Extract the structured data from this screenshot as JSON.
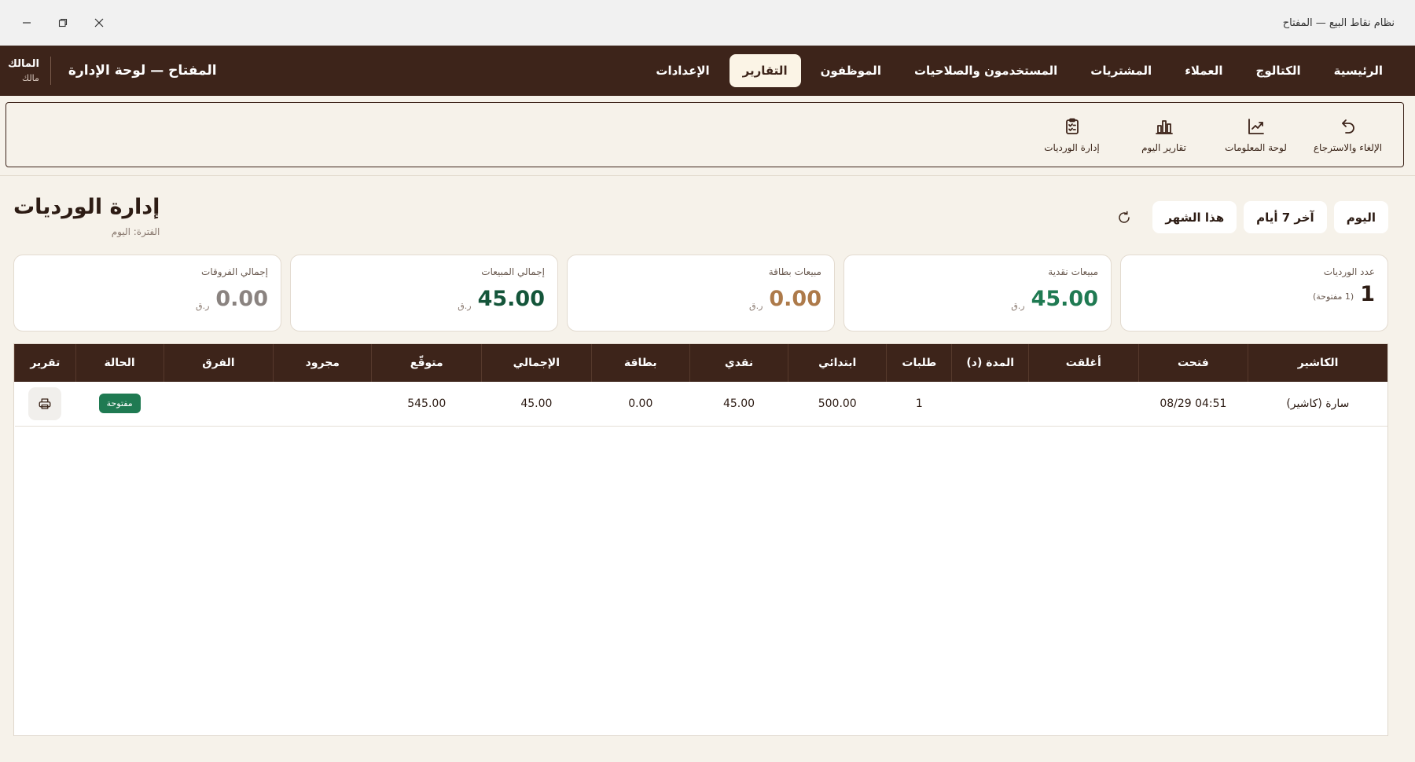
{
  "window": {
    "title": "نظام نقاط البيع — المفتاح"
  },
  "nav": {
    "tabs": [
      {
        "label": "الرئيسية",
        "active": false
      },
      {
        "label": "الكتالوج",
        "active": false
      },
      {
        "label": "العملاء",
        "active": false
      },
      {
        "label": "المشتريات",
        "active": false
      },
      {
        "label": "المستخدمون والصلاحيات",
        "active": false
      },
      {
        "label": "الموظفون",
        "active": false
      },
      {
        "label": "التقارير",
        "active": true
      },
      {
        "label": "الإعدادات",
        "active": false
      }
    ],
    "brand": "المفتاح — لوحة الإدارة",
    "user_name": "المالك",
    "user_role": "مالك"
  },
  "subnav": {
    "items": [
      {
        "label": "الإلغاء والاسترجاع",
        "icon": "undo-icon"
      },
      {
        "label": "لوحة المعلومات",
        "icon": "trend-chart-icon"
      },
      {
        "label": "تقارير اليوم",
        "icon": "bar-chart-icon"
      },
      {
        "label": "إدارة الورديات",
        "icon": "clipboard-check-icon"
      }
    ]
  },
  "page": {
    "title": "إدارة الورديات",
    "subtitle": "الفترة: اليوم",
    "periods": [
      "اليوم",
      "آخر 7 أيام",
      "هذا الشهر"
    ]
  },
  "kpis": {
    "shift_count_label": "عدد الورديات",
    "shift_count_value": "1",
    "shift_count_sub": "(1 مفتوحة)",
    "cash_label": "مبيعات نقدية",
    "cash_value": "45.00",
    "card_label": "مبيعات بطاقة",
    "card_value": "0.00",
    "total_label": "إجمالي المبيعات",
    "total_value": "45.00",
    "diff_label": "إجمالي الفروقات",
    "diff_value": "0.00",
    "currency": "ر.ق"
  },
  "table": {
    "headers": {
      "cashier": "الكاشير",
      "opened": "فتحت",
      "closed": "أغلقت",
      "duration": "المدة (د)",
      "orders": "طلبات",
      "initial": "ابتدائي",
      "cash": "نقدي",
      "card": "بطاقة",
      "total": "الإجمالي",
      "expected": "متوقّع",
      "counted": "مجرود",
      "diff": "الفرق",
      "status": "الحالة",
      "report": "تقرير"
    },
    "rows": [
      {
        "cashier": "سارة (كاشير)",
        "opened": "08/29 04:51",
        "closed": "",
        "duration": "",
        "orders": "1",
        "initial": "500.00",
        "cash": "45.00",
        "card": "0.00",
        "total": "45.00",
        "expected": "545.00",
        "counted": "",
        "diff": "",
        "status": "مفتوحة"
      }
    ]
  },
  "colors": {
    "primary": "#3d241a",
    "accent_cream": "#fbf4e6",
    "success": "#1f7a52"
  }
}
